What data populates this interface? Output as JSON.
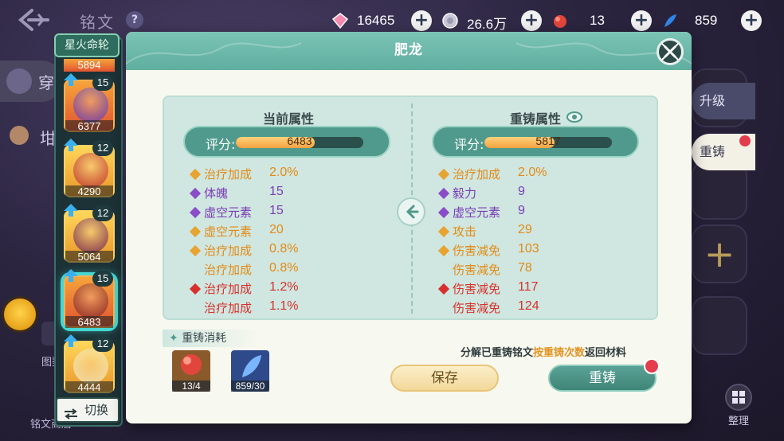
{
  "header": {
    "title": "铭文",
    "help": "?",
    "currencies": [
      {
        "icon": "pink-gem-icon",
        "value": "16465",
        "color": "#f58ab0"
      },
      {
        "icon": "silver-coin-icon",
        "value": "26.6万",
        "color": "#c8c8d8"
      },
      {
        "icon": "red-crystal-icon",
        "value": "13",
        "color": "#e2453c"
      },
      {
        "icon": "blue-feather-icon",
        "value": "859",
        "color": "#2f86e8"
      }
    ]
  },
  "background": {
    "left_tab": "穿",
    "left_item": "坩",
    "label_gallery": "图鉴",
    "label_shop": "铭文商店",
    "upgrade_tab": "升级",
    "recast_tab": "重铸",
    "sort_label": "整理"
  },
  "rune_list": {
    "tab": "星火命轮",
    "top_score": "5894",
    "runes": [
      {
        "level": "15",
        "score": "6377",
        "style": "red",
        "face": "#6a3fa8"
      },
      {
        "level": "12",
        "score": "4290",
        "style": "gold",
        "face": "#c23a2f"
      },
      {
        "level": "12",
        "score": "5064",
        "style": "gold",
        "face": "#7a3050"
      },
      {
        "level": "15",
        "score": "6483",
        "style": "red",
        "face": "#8a2a1c",
        "selected": true
      },
      {
        "level": "12",
        "score": "4444",
        "style": "gold",
        "face": "#f3e3b0"
      }
    ],
    "switch_label": "切换"
  },
  "modal": {
    "title": "肥龙",
    "current": {
      "title": "当前属性",
      "score_label": "评分:",
      "score": "6483",
      "score_fill": 0.62,
      "stats": [
        {
          "name": "治疗加成",
          "value": "2.0%",
          "color": "#e38a17",
          "bullet": "#e8a330"
        },
        {
          "name": "体魄",
          "value": "15",
          "color": "#7a3bb7",
          "bullet": "#8a4cc8"
        },
        {
          "name": "虚空元素",
          "value": "15",
          "color": "#7a3bb7",
          "bullet": "#8a4cc8"
        },
        {
          "name": "虚空元素",
          "value": "20",
          "color": "#e38a17",
          "bullet": "#e8a330"
        },
        {
          "name": "治疗加成",
          "value": "0.8%",
          "color": "#e38a17",
          "bullet": "#e8a330"
        },
        {
          "name": "治疗加成",
          "value": "0.8%",
          "color": "#e38a17",
          "bullet": ""
        },
        {
          "name": "治疗加成",
          "value": "1.2%",
          "color": "#d8302c",
          "bullet": "#d8302c"
        },
        {
          "name": "治疗加成",
          "value": "1.1%",
          "color": "#d8302c",
          "bullet": ""
        }
      ]
    },
    "recast": {
      "title": "重铸属性",
      "score_label": "评分:",
      "score": "5817",
      "score_fill": 0.55,
      "stats": [
        {
          "name": "治疗加成",
          "value": "2.0%",
          "color": "#e38a17",
          "bullet": "#e8a330"
        },
        {
          "name": "毅力",
          "value": "9",
          "color": "#7a3bb7",
          "bullet": "#8a4cc8"
        },
        {
          "name": "虚空元素",
          "value": "9",
          "color": "#7a3bb7",
          "bullet": "#8a4cc8"
        },
        {
          "name": "攻击",
          "value": "29",
          "color": "#e38a17",
          "bullet": "#e8a330"
        },
        {
          "name": "伤害减免",
          "value": "103",
          "color": "#e38a17",
          "bullet": "#e8a330"
        },
        {
          "name": "伤害减免",
          "value": "78",
          "color": "#e38a17",
          "bullet": ""
        },
        {
          "name": "伤害减免",
          "value": "117",
          "color": "#d8302c",
          "bullet": "#d8302c"
        },
        {
          "name": "伤害减免",
          "value": "124",
          "color": "#d8302c",
          "bullet": ""
        }
      ]
    },
    "cost": {
      "title": "重铸消耗",
      "items": [
        {
          "icon": "red-crystal-icon",
          "count": "13/4"
        },
        {
          "icon": "blue-feather-icon",
          "count": "859/30"
        }
      ]
    },
    "hint": {
      "prefix": "分解已重铸铭文",
      "highlight": "按重铸次数",
      "suffix": "返回材料"
    },
    "save_label": "保存",
    "recast_label": "重铸"
  }
}
